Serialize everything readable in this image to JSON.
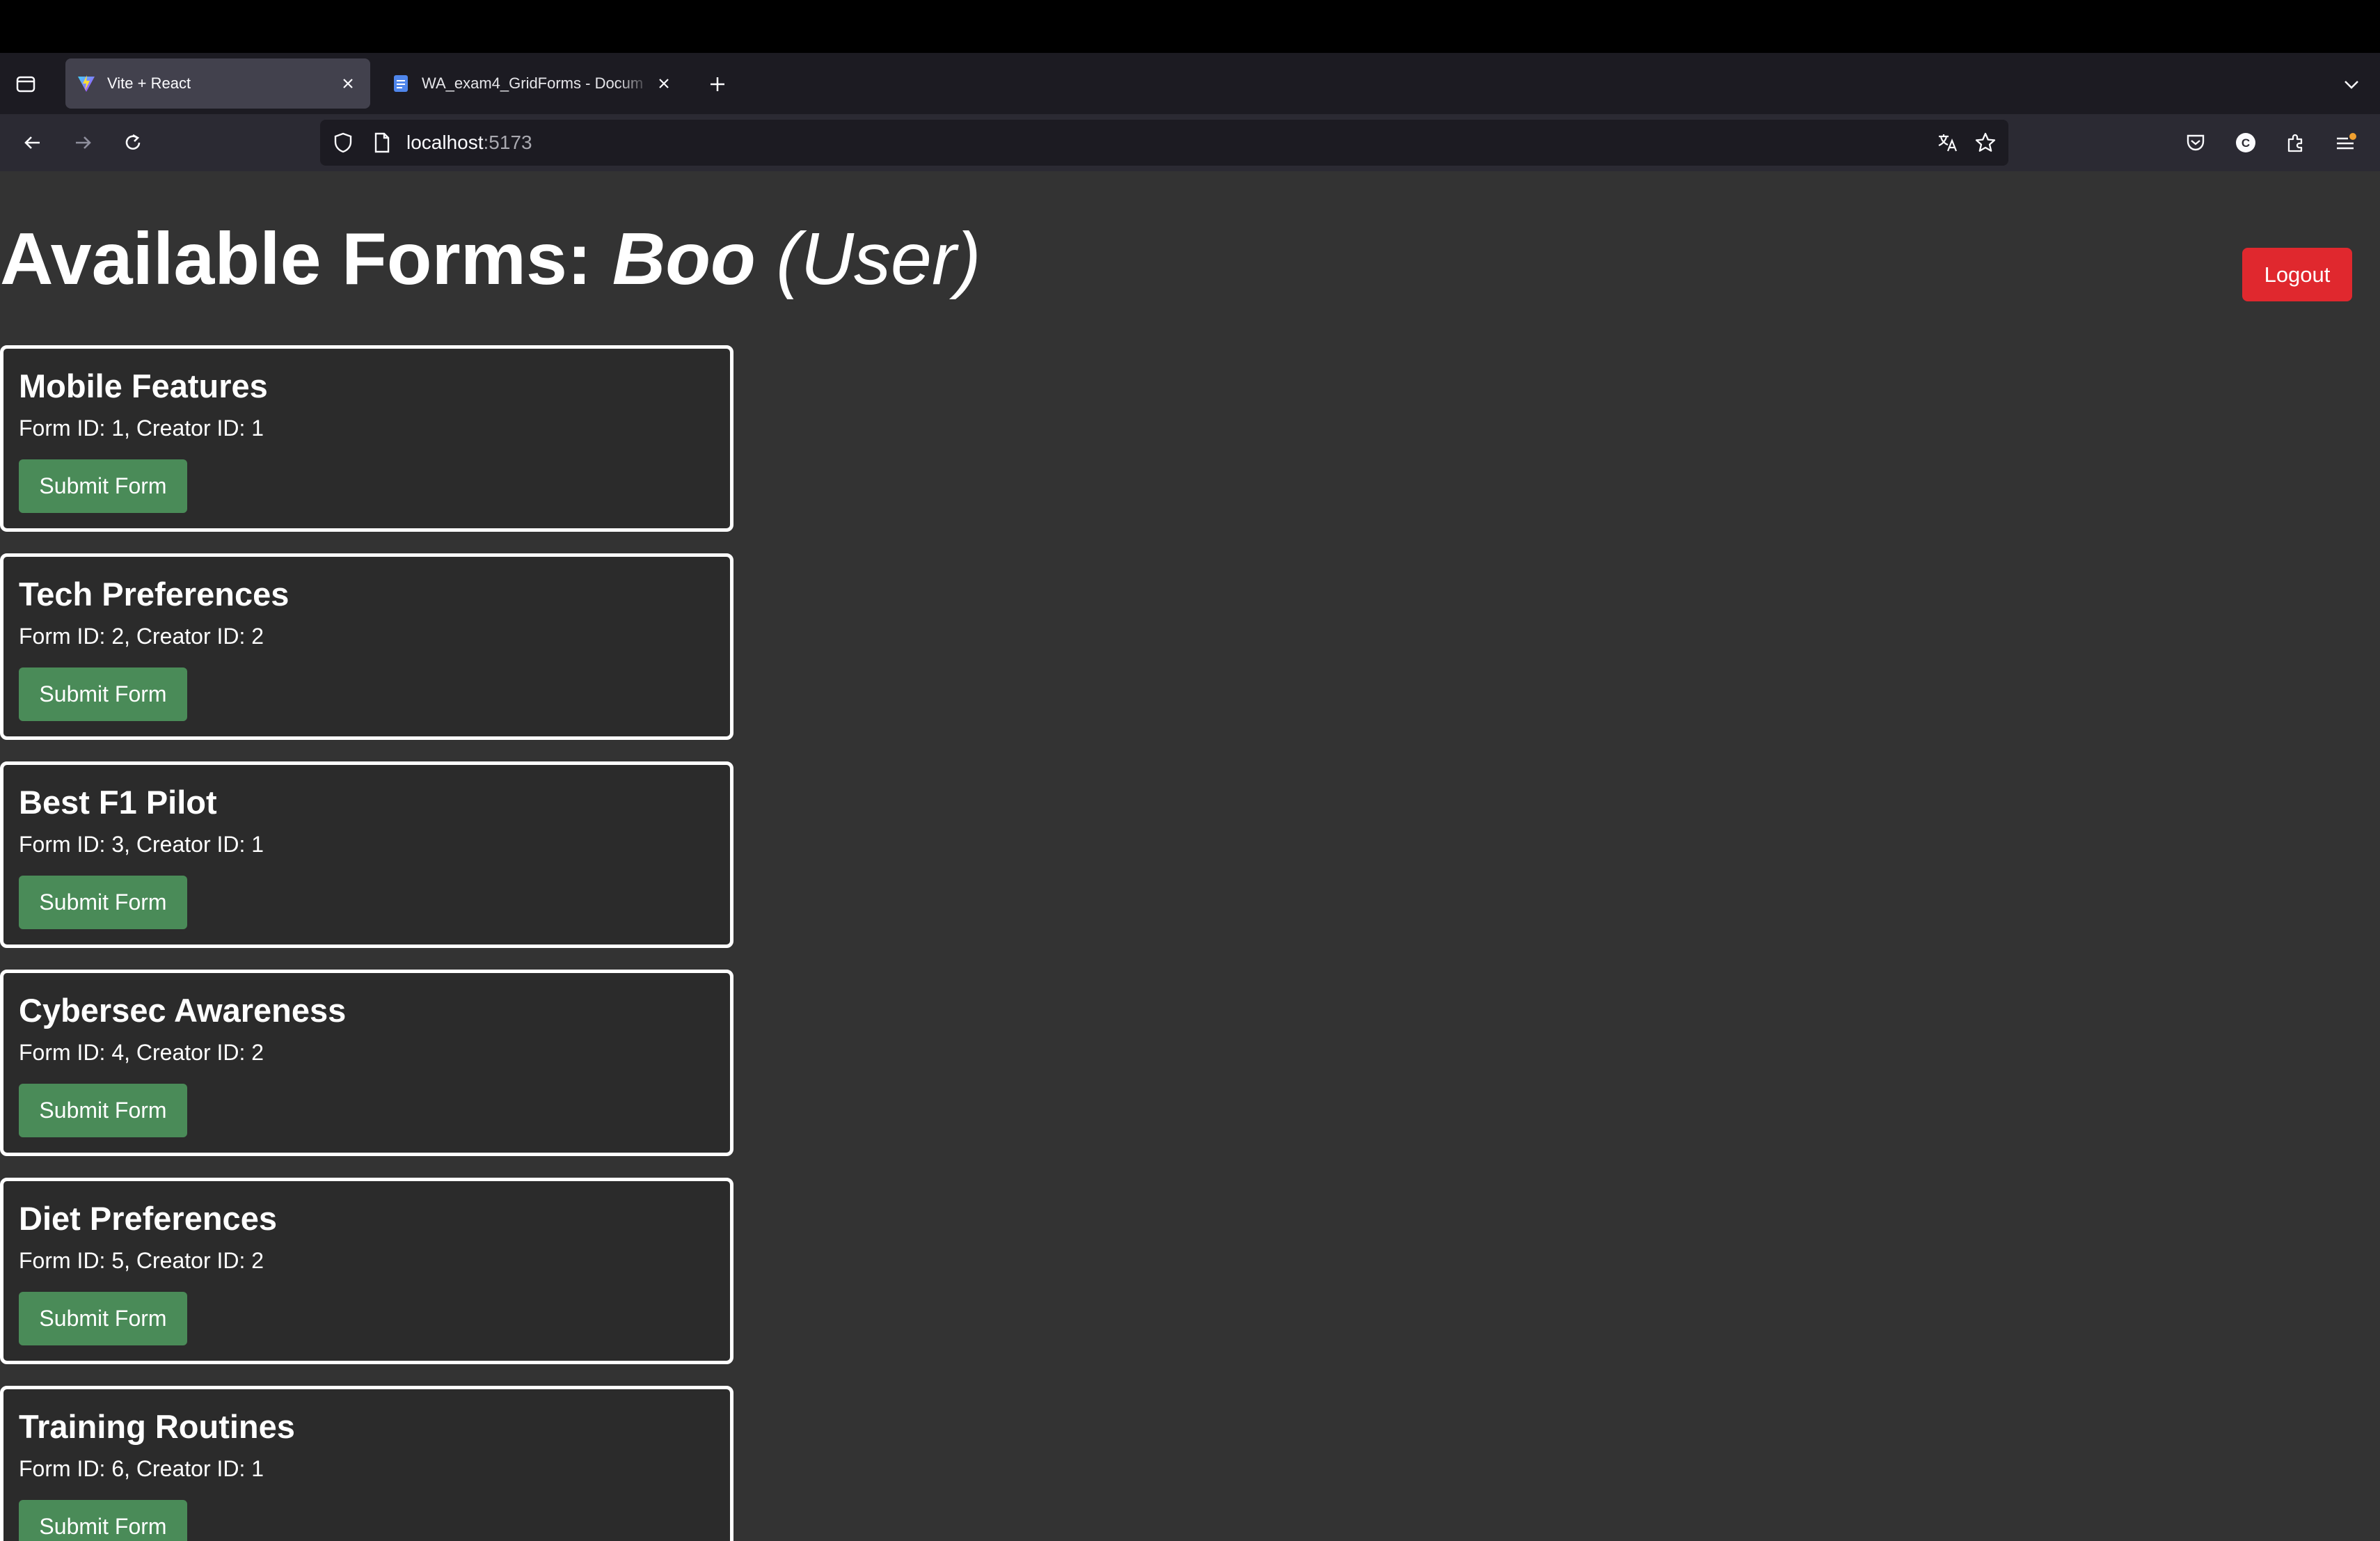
{
  "browser": {
    "tabs": [
      {
        "title": "Vite + React",
        "active": true
      },
      {
        "title": "WA_exam4_GridForms - Docum",
        "active": false
      }
    ],
    "url_host": "localhost",
    "url_port": ":5173"
  },
  "page": {
    "title_prefix": "Available Forms: ",
    "user_name": "Boo",
    "user_role": "(User)",
    "logout_label": "Logout"
  },
  "forms": [
    {
      "title": "Mobile Features",
      "meta_id": "Form ID: 1,",
      "meta_creator": "Creator ID: 1",
      "button": "Submit Form"
    },
    {
      "title": "Tech Preferences",
      "meta_id": "Form ID: 2,",
      "meta_creator": "Creator ID: 2",
      "button": "Submit Form"
    },
    {
      "title": "Best F1 Pilot",
      "meta_id": "Form ID: 3,",
      "meta_creator": "Creator ID: 1",
      "button": "Submit Form"
    },
    {
      "title": "Cybersec Awareness",
      "meta_id": "Form ID: 4,",
      "meta_creator": "Creator ID: 2",
      "button": "Submit Form"
    },
    {
      "title": "Diet Preferences",
      "meta_id": "Form ID: 5,",
      "meta_creator": "Creator ID: 2",
      "button": "Submit Form"
    },
    {
      "title": "Training Routines",
      "meta_id": "Form ID: 6,",
      "meta_creator": "Creator ID: 1",
      "button": "Submit Form"
    }
  ],
  "colors": {
    "background": "#333333",
    "logout": "#e0282e",
    "submit": "#4a8b58",
    "card_border": "#ffffff"
  },
  "icons": {
    "tab_overview": "tab-overview-icon",
    "vite_favicon": "vite-favicon-icon",
    "docs_favicon": "docs-favicon-icon",
    "close": "close-icon",
    "new_tab": "plus-icon",
    "tab_list": "chevron-down-icon",
    "back": "back-arrow-icon",
    "forward": "forward-arrow-icon",
    "reload": "reload-icon",
    "shield": "shield-icon",
    "page": "page-icon",
    "translate": "translate-icon",
    "bookmark": "star-icon",
    "pocket": "pocket-icon",
    "account": "account-icon",
    "extensions": "extensions-icon",
    "menu": "menu-icon"
  }
}
